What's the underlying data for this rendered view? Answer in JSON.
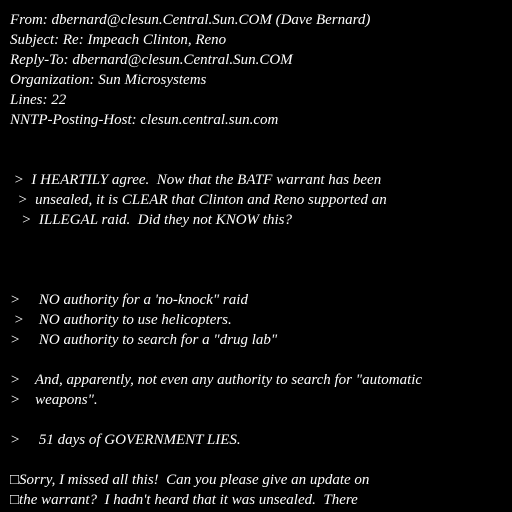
{
  "header": {
    "from": "From: dbernard@clesun.Central.Sun.COM (Dave Bernard)",
    "subject": "Subject: Re: Impeach Clinton, Reno",
    "reply_to": "Reply-To: dbernard@clesun.Central.Sun.COM",
    "organization": "Organization: Sun Microsystems",
    "lines": "Lines: 22",
    "nntp_posting_host": "NNTP-Posting-Host: clesun.central.sun.com"
  },
  "body": {
    "quote1": [
      " >  I HEARTILY agree.  Now that the BATF warrant has been",
      "  >  unsealed, it is CLEAR that Clinton and Reno supported an",
      "   >  ILLEGAL raid.  Did they not KNOW this?"
    ],
    "quote2": [
      ">     NO authority for a 'no-knock\" raid",
      " >    NO authority to use helicopters.",
      ">     NO authority to search for a \"drug lab\""
    ],
    "quote3": [
      ">    And, apparently, not even any authority to search for \"automatic",
      ">    weapons\"."
    ],
    "quote4": [
      ">     51 days of GOVERNMENT LIES."
    ],
    "reply": [
      "□Sorry, I missed all this!  Can you please give an update on",
      "□the warrant?  I hadn't heard that it was unsealed.  There"
    ]
  }
}
